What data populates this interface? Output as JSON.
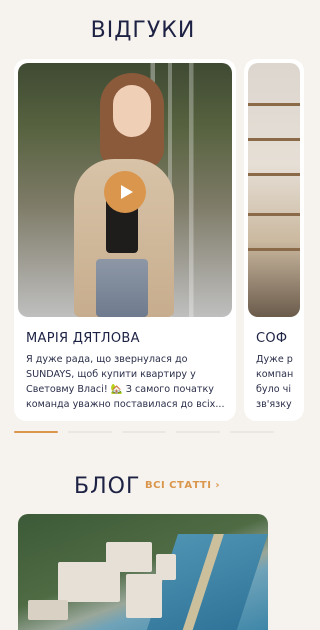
{
  "reviews": {
    "title": "ВІДГУКИ",
    "cards": [
      {
        "name": "МАРІЯ ДЯТЛОВА",
        "text": "Я дуже рада, що звернулася до SUNDAYS, щоб купити квартиру у Световму Власі! 🏡 З самого початку команда уважно поставилася до всіх..."
      },
      {
        "name": "СОФ",
        "text": "Дуже р компан було чі зв'язку"
      }
    ],
    "pagination": {
      "total": 5,
      "active": 0
    }
  },
  "blog": {
    "title": "БЛОГ",
    "all_link": "ВСІ СТАТТІ ›"
  },
  "colors": {
    "accent": "#d9964c",
    "navy": "#1d2244",
    "background": "#f6f2ee"
  },
  "icons": {
    "play": "play-icon"
  }
}
